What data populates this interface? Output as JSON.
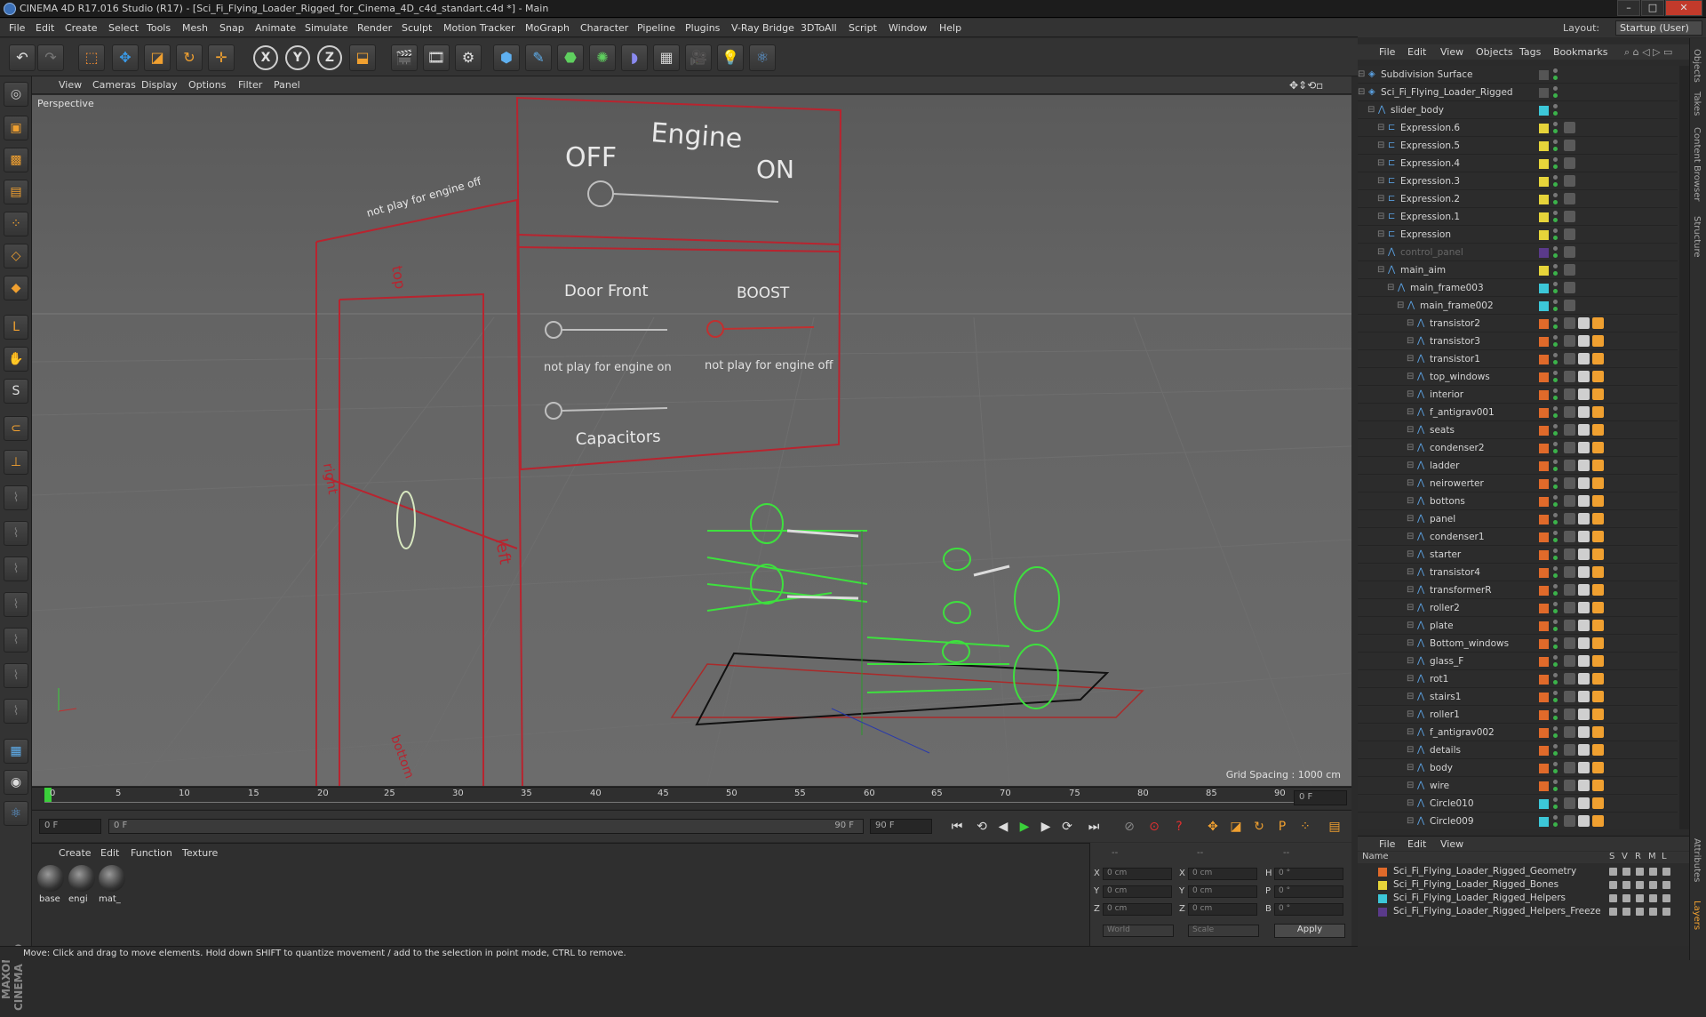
{
  "window": {
    "title": "CINEMA 4D R17.016 Studio (R17) - [Sci_Fi_Flying_Loader_Rigged_for_Cinema_4D_c4d_standart.c4d *] - Main",
    "min": "–",
    "max": "□",
    "close": "✕"
  },
  "menu": [
    "File",
    "Edit",
    "Create",
    "Select",
    "Tools",
    "Mesh",
    "Snap",
    "Animate",
    "Simulate",
    "Render",
    "Sculpt",
    "Motion Tracker",
    "MoGraph",
    "Character",
    "Pipeline",
    "Plugins",
    "V-Ray Bridge",
    "3DToAll",
    "Script",
    "Window",
    "Help"
  ],
  "layout": {
    "label": "Layout:",
    "value": "Startup (User)"
  },
  "toolbar": {
    "axis_x": "X",
    "axis_y": "Y",
    "axis_z": "Z"
  },
  "viewport": {
    "menu": [
      "View",
      "Cameras",
      "Display",
      "Options",
      "Filter",
      "Panel"
    ],
    "label": "Perspective",
    "grid_spacing": "Grid Spacing : 1000 cm",
    "panel_texts": {
      "engine": "Engine",
      "off": "OFF",
      "on": "ON",
      "door_front": "Door Front",
      "boost": "BOOST",
      "not_play_on": "not play for engine on",
      "not_play_off": "not play for engine off",
      "capacitors": "Capacitors",
      "side_text": "not play for engine off",
      "top": "top",
      "right": "right",
      "left": "left",
      "bottom": "bottom"
    }
  },
  "timeline": {
    "ticks": [
      "0",
      "5",
      "10",
      "15",
      "20",
      "25",
      "30",
      "35",
      "40",
      "45",
      "50",
      "55",
      "60",
      "65",
      "70",
      "75",
      "80",
      "85",
      "90"
    ],
    "frame": "0 F"
  },
  "playbar": {
    "start": "0 F",
    "current": "0 F",
    "end_slider": "90 F",
    "end": "90 F"
  },
  "materials": {
    "menu": [
      "Create",
      "Edit",
      "Function",
      "Texture"
    ],
    "items": [
      "base",
      "engi",
      "mat_"
    ]
  },
  "coords": {
    "labels_left": [
      "X",
      "Y",
      "Z"
    ],
    "values_left": [
      "0 cm",
      "0 cm",
      "0 cm"
    ],
    "labels_mid": [
      "X",
      "Y",
      "Z"
    ],
    "values_mid": [
      "0 cm",
      "0 cm",
      "0 cm"
    ],
    "labels_right": [
      "H",
      "P",
      "B"
    ],
    "values_right": [
      "0 °",
      "0 °",
      "0 °"
    ],
    "dash1": "--",
    "dash2": "--",
    "dash3": "--",
    "world": "World",
    "scale": "Scale",
    "apply": "Apply"
  },
  "status": "Move: Click and drag to move elements. Hold down SHIFT to quantize movement / add to the selection in point mode, CTRL to remove.",
  "object_manager": {
    "menu": [
      "File",
      "Edit",
      "View",
      "Objects",
      "Tags",
      "Bookmarks"
    ],
    "rows": [
      {
        "name": "Subdivision Surface",
        "indent": 0,
        "color": "none"
      },
      {
        "name": "Sci_Fi_Flying_Loader_Rigged",
        "indent": 0,
        "color": "none"
      },
      {
        "name": "slider_body",
        "indent": 1,
        "color": "#3cc7d8"
      },
      {
        "name": "Expression.6",
        "indent": 2,
        "color": "#e6d43a"
      },
      {
        "name": "Expression.5",
        "indent": 2,
        "color": "#e6d43a"
      },
      {
        "name": "Expression.4",
        "indent": 2,
        "color": "#e6d43a"
      },
      {
        "name": "Expression.3",
        "indent": 2,
        "color": "#e6d43a"
      },
      {
        "name": "Expression.2",
        "indent": 2,
        "color": "#e6d43a"
      },
      {
        "name": "Expression.1",
        "indent": 2,
        "color": "#e6d43a"
      },
      {
        "name": "Expression",
        "indent": 2,
        "color": "#e6d43a"
      },
      {
        "name": "control_panel",
        "indent": 2,
        "color": "#5a3a8a"
      },
      {
        "name": "main_aim",
        "indent": 2,
        "color": "#e6d43a"
      },
      {
        "name": "main_frame003",
        "indent": 3,
        "color": "#3cc7d8"
      },
      {
        "name": "main_frame002",
        "indent": 4,
        "color": "#3cc7d8"
      },
      {
        "name": "transistor2",
        "indent": 5,
        "color": "#e06a2a"
      },
      {
        "name": "transistor3",
        "indent": 5,
        "color": "#e06a2a"
      },
      {
        "name": "transistor1",
        "indent": 5,
        "color": "#e06a2a"
      },
      {
        "name": "top_windows",
        "indent": 5,
        "color": "#e06a2a"
      },
      {
        "name": "interior",
        "indent": 5,
        "color": "#e06a2a"
      },
      {
        "name": "f_antigrav001",
        "indent": 5,
        "color": "#e06a2a"
      },
      {
        "name": "seats",
        "indent": 5,
        "color": "#e06a2a"
      },
      {
        "name": "condenser2",
        "indent": 5,
        "color": "#e06a2a"
      },
      {
        "name": "ladder",
        "indent": 5,
        "color": "#e06a2a"
      },
      {
        "name": "neirowerter",
        "indent": 5,
        "color": "#e06a2a"
      },
      {
        "name": "bottons",
        "indent": 5,
        "color": "#e06a2a"
      },
      {
        "name": "panel",
        "indent": 5,
        "color": "#e06a2a"
      },
      {
        "name": "condenser1",
        "indent": 5,
        "color": "#e06a2a"
      },
      {
        "name": "starter",
        "indent": 5,
        "color": "#e06a2a"
      },
      {
        "name": "transistor4",
        "indent": 5,
        "color": "#e06a2a"
      },
      {
        "name": "transformerR",
        "indent": 5,
        "color": "#e06a2a"
      },
      {
        "name": "roller2",
        "indent": 5,
        "color": "#e06a2a"
      },
      {
        "name": "plate",
        "indent": 5,
        "color": "#e06a2a"
      },
      {
        "name": "Bottom_windows",
        "indent": 5,
        "color": "#e06a2a"
      },
      {
        "name": "glass_F",
        "indent": 5,
        "color": "#e06a2a"
      },
      {
        "name": "rot1",
        "indent": 5,
        "color": "#e06a2a"
      },
      {
        "name": "stairs1",
        "indent": 5,
        "color": "#e06a2a"
      },
      {
        "name": "roller1",
        "indent": 5,
        "color": "#e06a2a"
      },
      {
        "name": "f_antigrav002",
        "indent": 5,
        "color": "#e06a2a"
      },
      {
        "name": "details",
        "indent": 5,
        "color": "#e06a2a"
      },
      {
        "name": "body",
        "indent": 5,
        "color": "#e06a2a"
      },
      {
        "name": "wire",
        "indent": 5,
        "color": "#e06a2a"
      },
      {
        "name": "Circle010",
        "indent": 5,
        "color": "#3cc7d8"
      },
      {
        "name": "Circle009",
        "indent": 5,
        "color": "#3cc7d8"
      }
    ]
  },
  "layer_manager": {
    "menu": [
      "File",
      "Edit",
      "View"
    ],
    "header": {
      "name": "Name",
      "cols": [
        "S",
        "V",
        "R",
        "M",
        "L"
      ]
    },
    "rows": [
      {
        "name": "Sci_Fi_Flying_Loader_Rigged_Geometry",
        "color": "#e06a2a"
      },
      {
        "name": "Sci_Fi_Flying_Loader_Rigged_Bones",
        "color": "#e6d43a"
      },
      {
        "name": "Sci_Fi_Flying_Loader_Rigged_Helpers",
        "color": "#3cc7d8"
      },
      {
        "name": "Sci_Fi_Flying_Loader_Rigged_Helpers_Freeze",
        "color": "#5a3a8a"
      }
    ]
  },
  "side_tabs": [
    "Objects",
    "Takes",
    "Content Browser",
    "Structure",
    "Attributes",
    "Layers"
  ]
}
